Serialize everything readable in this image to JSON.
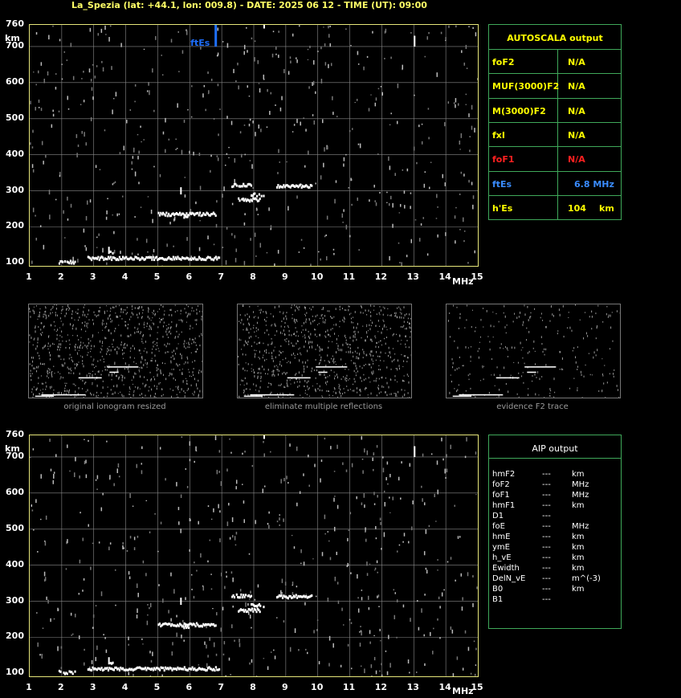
{
  "header": "La_Spezia (lat: +44.1, lon: 009.8) - DATE: 2025 06 12 - TIME (UT): 09:00",
  "axis": {
    "y_unit": "km",
    "x_unit": "MHz",
    "y_ticks": [
      "760",
      "700",
      "600",
      "500",
      "400",
      "300",
      "200",
      "100"
    ],
    "x_ticks": [
      "1",
      "2",
      "3",
      "4",
      "5",
      "6",
      "7",
      "8",
      "9",
      "10",
      "11",
      "12",
      "13",
      "14",
      "15"
    ]
  },
  "fte_marker_label": "ftEs",
  "autoscala": {
    "title": "AUTOSCALA output",
    "rows": [
      {
        "name": "foF2",
        "value": "N/A",
        "color": "#ffff00"
      },
      {
        "name": "MUF(3000)F2",
        "value": "N/A",
        "color": "#ffff00"
      },
      {
        "name": "M(3000)F2",
        "value": "N/A",
        "color": "#ffff00"
      },
      {
        "name": "fxI",
        "value": "N/A",
        "color": "#ffff00"
      },
      {
        "name": "foF1",
        "value": "N/A",
        "color": "#ff2020"
      },
      {
        "name": "ftEs",
        "value": "6.8 MHz",
        "color": "#3a8cff"
      },
      {
        "name": "h'Es",
        "value": "104",
        "unit": "km",
        "color": "#ffff00"
      }
    ]
  },
  "thumbnails": {
    "captions": [
      "original ionogram resized",
      "eliminate multiple reflections",
      "evidence F2 trace"
    ]
  },
  "aip": {
    "title": "AIP output",
    "rows": [
      {
        "name": "hmF2",
        "value": "---",
        "unit": "km"
      },
      {
        "name": "foF2",
        "value": "---",
        "unit": "MHz"
      },
      {
        "name": "foF1",
        "value": "---",
        "unit": "MHz"
      },
      {
        "name": "hmF1",
        "value": "---",
        "unit": "km"
      },
      {
        "name": "D1",
        "value": "---",
        "unit": ""
      },
      {
        "name": "foE",
        "value": "---",
        "unit": "MHz"
      },
      {
        "name": "hmE",
        "value": "---",
        "unit": "km"
      },
      {
        "name": "ymE",
        "value": "---",
        "unit": "km"
      },
      {
        "name": "h_vE",
        "value": "---",
        "unit": "km"
      },
      {
        "name": "Ewidth",
        "value": "---",
        "unit": "km"
      },
      {
        "name": "DelN_vE",
        "value": "---",
        "unit": "m^(-3)"
      },
      {
        "name": "B0",
        "value": "---",
        "unit": "km"
      },
      {
        "name": "B1",
        "value": "---",
        "unit": ""
      }
    ]
  },
  "colors": {
    "grid": "#8a8a8a",
    "frame": "#e6e67a",
    "table_border": "#3fa85a",
    "trace": "#ffffff",
    "ftes_marker": "#1e6fff"
  }
}
